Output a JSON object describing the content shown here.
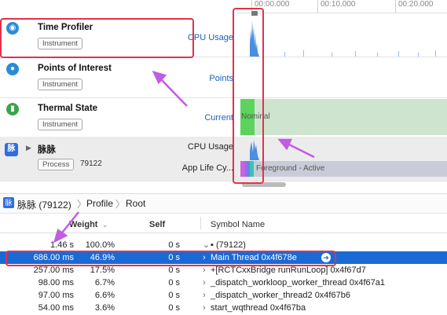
{
  "ruler": {
    "ticks": [
      "00:00.000",
      "00:10.000",
      "00:20.000"
    ]
  },
  "tracks": [
    {
      "title": "Time Profiler",
      "badge": "Instrument",
      "metric": "CPU Usage",
      "icon": "gauge-icon",
      "icon_color": "#2a8cd8"
    },
    {
      "title": "Points of Interest",
      "badge": "Instrument",
      "metric": "Points",
      "icon": "pin-icon",
      "icon_color": "#2a8cd8"
    },
    {
      "title": "Thermal State",
      "badge": "Instrument",
      "metric": "Current",
      "icon": "thermometer-icon",
      "icon_color": "#3aa44a",
      "state_text": "Nominal"
    },
    {
      "title": "脉脉",
      "badge": "Process",
      "pid": "79122",
      "metric": "CPU Usage",
      "metric2": "App Life Cy...",
      "icon": "app-icon",
      "icon_text": "脉",
      "icon_color": "#2f6ee0",
      "state_text": "Foreground - Active"
    }
  ],
  "breadcrumb": {
    "process": "脉脉 (79122)",
    "profile": "Profile",
    "root": "Root"
  },
  "table": {
    "headers": {
      "weight": "Weight",
      "self": "Self",
      "symbol": "Symbol Name"
    },
    "rows": [
      {
        "weight": "1.46 s",
        "percent": "100.0%",
        "self": "0 s",
        "symbol": "▪ (79122)",
        "selected": false
      },
      {
        "weight": "686.00 ms",
        "percent": "46.9%",
        "self": "0 s",
        "symbol": "Main Thread  0x4f678e",
        "selected": true
      },
      {
        "weight": "257.00 ms",
        "percent": "17.5%",
        "self": "0 s",
        "symbol": "+[RCTCxxBridge runRunLoop]  0x4f67d7",
        "selected": false
      },
      {
        "weight": "98.00 ms",
        "percent": "6.7%",
        "self": "0 s",
        "symbol": "_dispatch_workloop_worker_thread  0x4f67a1",
        "selected": false
      },
      {
        "weight": "97.00 ms",
        "percent": "6.6%",
        "self": "0 s",
        "symbol": "_dispatch_worker_thread2  0x4f67b6",
        "selected": false
      },
      {
        "weight": "54.00 ms",
        "percent": "3.6%",
        "self": "0 s",
        "symbol": "start_wqthread  0x4f67ba",
        "selected": false
      }
    ]
  },
  "colors": {
    "accent": "#1a6ad6",
    "annotation_red": "#e0324b",
    "annotation_purple": "#c05de0",
    "thermal_green": "#5cd35c"
  }
}
